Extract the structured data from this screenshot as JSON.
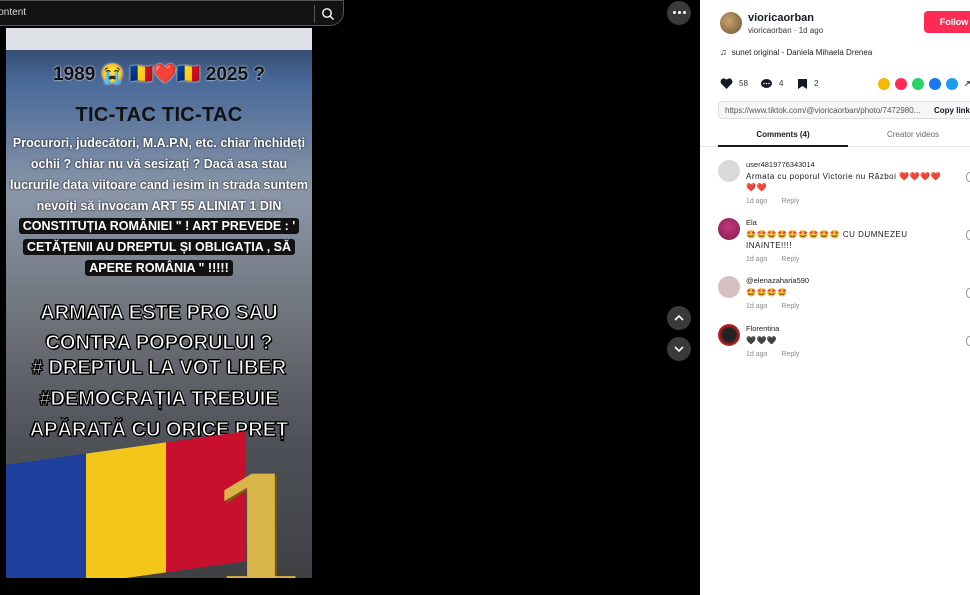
{
  "viewer": {
    "search_text": "ated content",
    "photo": {
      "top_line": "1989 😭   🇷🇴❤️🇷🇴   2025 ?",
      "tictac": "TIC-TAC          TIC-TAC",
      "body_lines": [
        "Procurori, judecători, M.A.P.N, etc.  chiar închideți",
        "ochii ? chiar nu vă sesizați ? Dacă  asa stau",
        "lucrurile data viitoare cand iesim in strada suntem",
        "nevoiți să invocam  ART 55 ALINIAT 1 DIN"
      ],
      "highlight_lines": [
        "CONSTITUȚIA ROMÂNIEI \" !  ART PREVEDE : '",
        "CETĂȚENII AU DREPTUL ȘI OBLIGAȚIA , SĂ",
        "APERE ROMÂNIA \" !!!!!"
      ],
      "big_lines": [
        "ARMATA ESTE PRO SAU",
        "CONTRA POPORULUI ?",
        "# DREPTUL LA VOT LIBER",
        "#DEMOCRAȚIA TREBUIE",
        "APĂRATĂ  CU ORICE PREȚ"
      ],
      "badge": "1"
    }
  },
  "post": {
    "username": "vioricaorban",
    "sub": "vioricaorban · 1d ago",
    "follow_label": "Follow",
    "music": "sunet original - Daniela Mihaela Drenea",
    "likes": "58",
    "comments_count": "4",
    "saves": "2",
    "link": "https://www.tiktok.com/@vioricaorban/photo/7472980...",
    "copy_link": "Copy link"
  },
  "tabs": {
    "comments": "Comments (4)",
    "creator": "Creator videos"
  },
  "comments": [
    {
      "user": "user4819776343014",
      "text": "Armata cu poporul Victorie nu Război ❤️❤️❤️❤️❤️❤️",
      "time": "1d ago",
      "reply": "Reply"
    },
    {
      "user": "Ela",
      "text": "🤩🤩🤩🤩🤩🤩🤩🤩🤩 CU DUMNEZEU INAINTE!!!!",
      "time": "1d ago",
      "reply": "Reply"
    },
    {
      "user": "@elenazaharia590",
      "text": "🤩🤩🤩🤩",
      "time": "1d ago",
      "reply": "Reply"
    },
    {
      "user": "Florentina",
      "text": "🖤🖤🖤",
      "time": "1d ago",
      "reply": "Reply"
    }
  ],
  "colors": {
    "follow": "#fe2c55",
    "flag_blue": "#1f3f9e",
    "flag_yellow": "#f4c619",
    "flag_red": "#c8102e"
  }
}
